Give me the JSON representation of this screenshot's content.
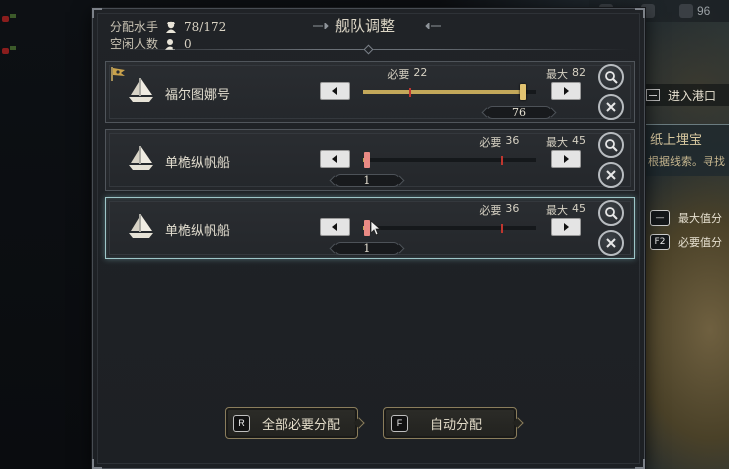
{
  "header": {
    "sailors_label": "分配水手",
    "sailors_value": "78/172",
    "idle_label": "空闲人数",
    "idle_value": "0",
    "title": "舰队调整"
  },
  "ships": [
    {
      "name": "福尔图娜号",
      "flagship": true,
      "required_label": "必要",
      "required": 22,
      "max_label": "最大",
      "max": 82,
      "assigned": 76,
      "handle_color": "#e1c270"
    },
    {
      "name": "单桅纵帆船",
      "flagship": false,
      "required_label": "必要",
      "required": 36,
      "max_label": "最大",
      "max": 45,
      "assigned": 1,
      "handle_color": "#e98a84"
    },
    {
      "name": "单桅纵帆船",
      "flagship": false,
      "selected": true,
      "required_label": "必要",
      "required": 36,
      "max_label": "最大",
      "max": 45,
      "assigned": 1,
      "handle_color": "#e98a84"
    }
  ],
  "footer": {
    "assign_required": {
      "key": "R",
      "label": "全部必要分配"
    },
    "auto_assign": {
      "key": "F",
      "label": "自动分配"
    }
  },
  "sidebar": {
    "enter_port": "进入港口",
    "quest_title": "纸上埋宝",
    "quest_sub": "根据线索。寻找",
    "legend_max": "最大值分",
    "legend_max_key": "—",
    "legend_req": "必要值分",
    "legend_req_key": "F2",
    "hud_value": "96"
  },
  "colors": {
    "accent_gold": "#c3a85a",
    "required_marker": "#c0362f",
    "selected_border": "#9ec6c8"
  }
}
